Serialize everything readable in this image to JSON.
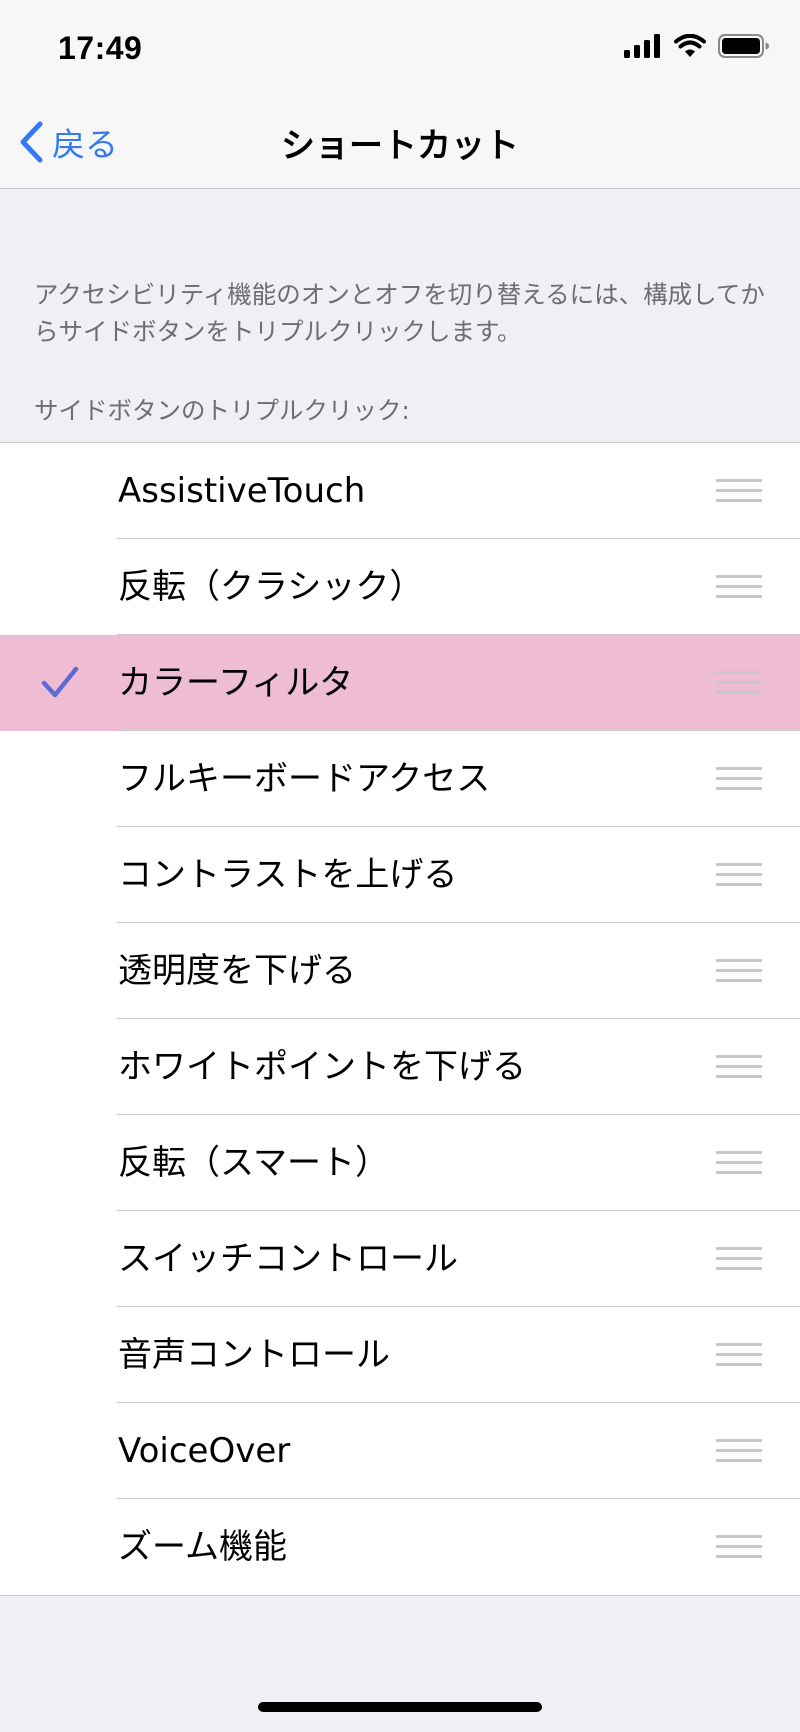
{
  "status_bar": {
    "time": "17:49"
  },
  "nav": {
    "back_label": "戻る",
    "title": "ショートカット"
  },
  "description": "アクセシビリティ機能のオンとオフを切り替えるには、構成してからサイドボタンをトリプルクリックします。",
  "section_header": "サイドボタンのトリプルクリック:",
  "items": [
    {
      "label": "AssistiveTouch",
      "checked": false
    },
    {
      "label": "反転（クラシック）",
      "checked": false
    },
    {
      "label": "カラーフィルタ",
      "checked": true
    },
    {
      "label": "フルキーボードアクセス",
      "checked": false
    },
    {
      "label": "コントラストを上げる",
      "checked": false
    },
    {
      "label": "透明度を下げる",
      "checked": false
    },
    {
      "label": "ホワイトポイントを下げる",
      "checked": false
    },
    {
      "label": "反転（スマート）",
      "checked": false
    },
    {
      "label": "スイッチコントロール",
      "checked": false
    },
    {
      "label": "音声コントロール",
      "checked": false
    },
    {
      "label": "VoiceOver",
      "checked": false
    },
    {
      "label": "ズーム機能",
      "checked": false
    }
  ],
  "icons": {
    "back": "chevron-left-icon",
    "checkmark": "checkmark-icon",
    "drag_handle": "reorder-handle-icon",
    "signal": "cellular-signal-icon",
    "wifi": "wifi-icon",
    "battery": "battery-icon"
  },
  "colors": {
    "accent": "#3478f6",
    "checkmark": "#5d6ad6",
    "highlight": "#eebdd3",
    "background": "#efeff4"
  }
}
